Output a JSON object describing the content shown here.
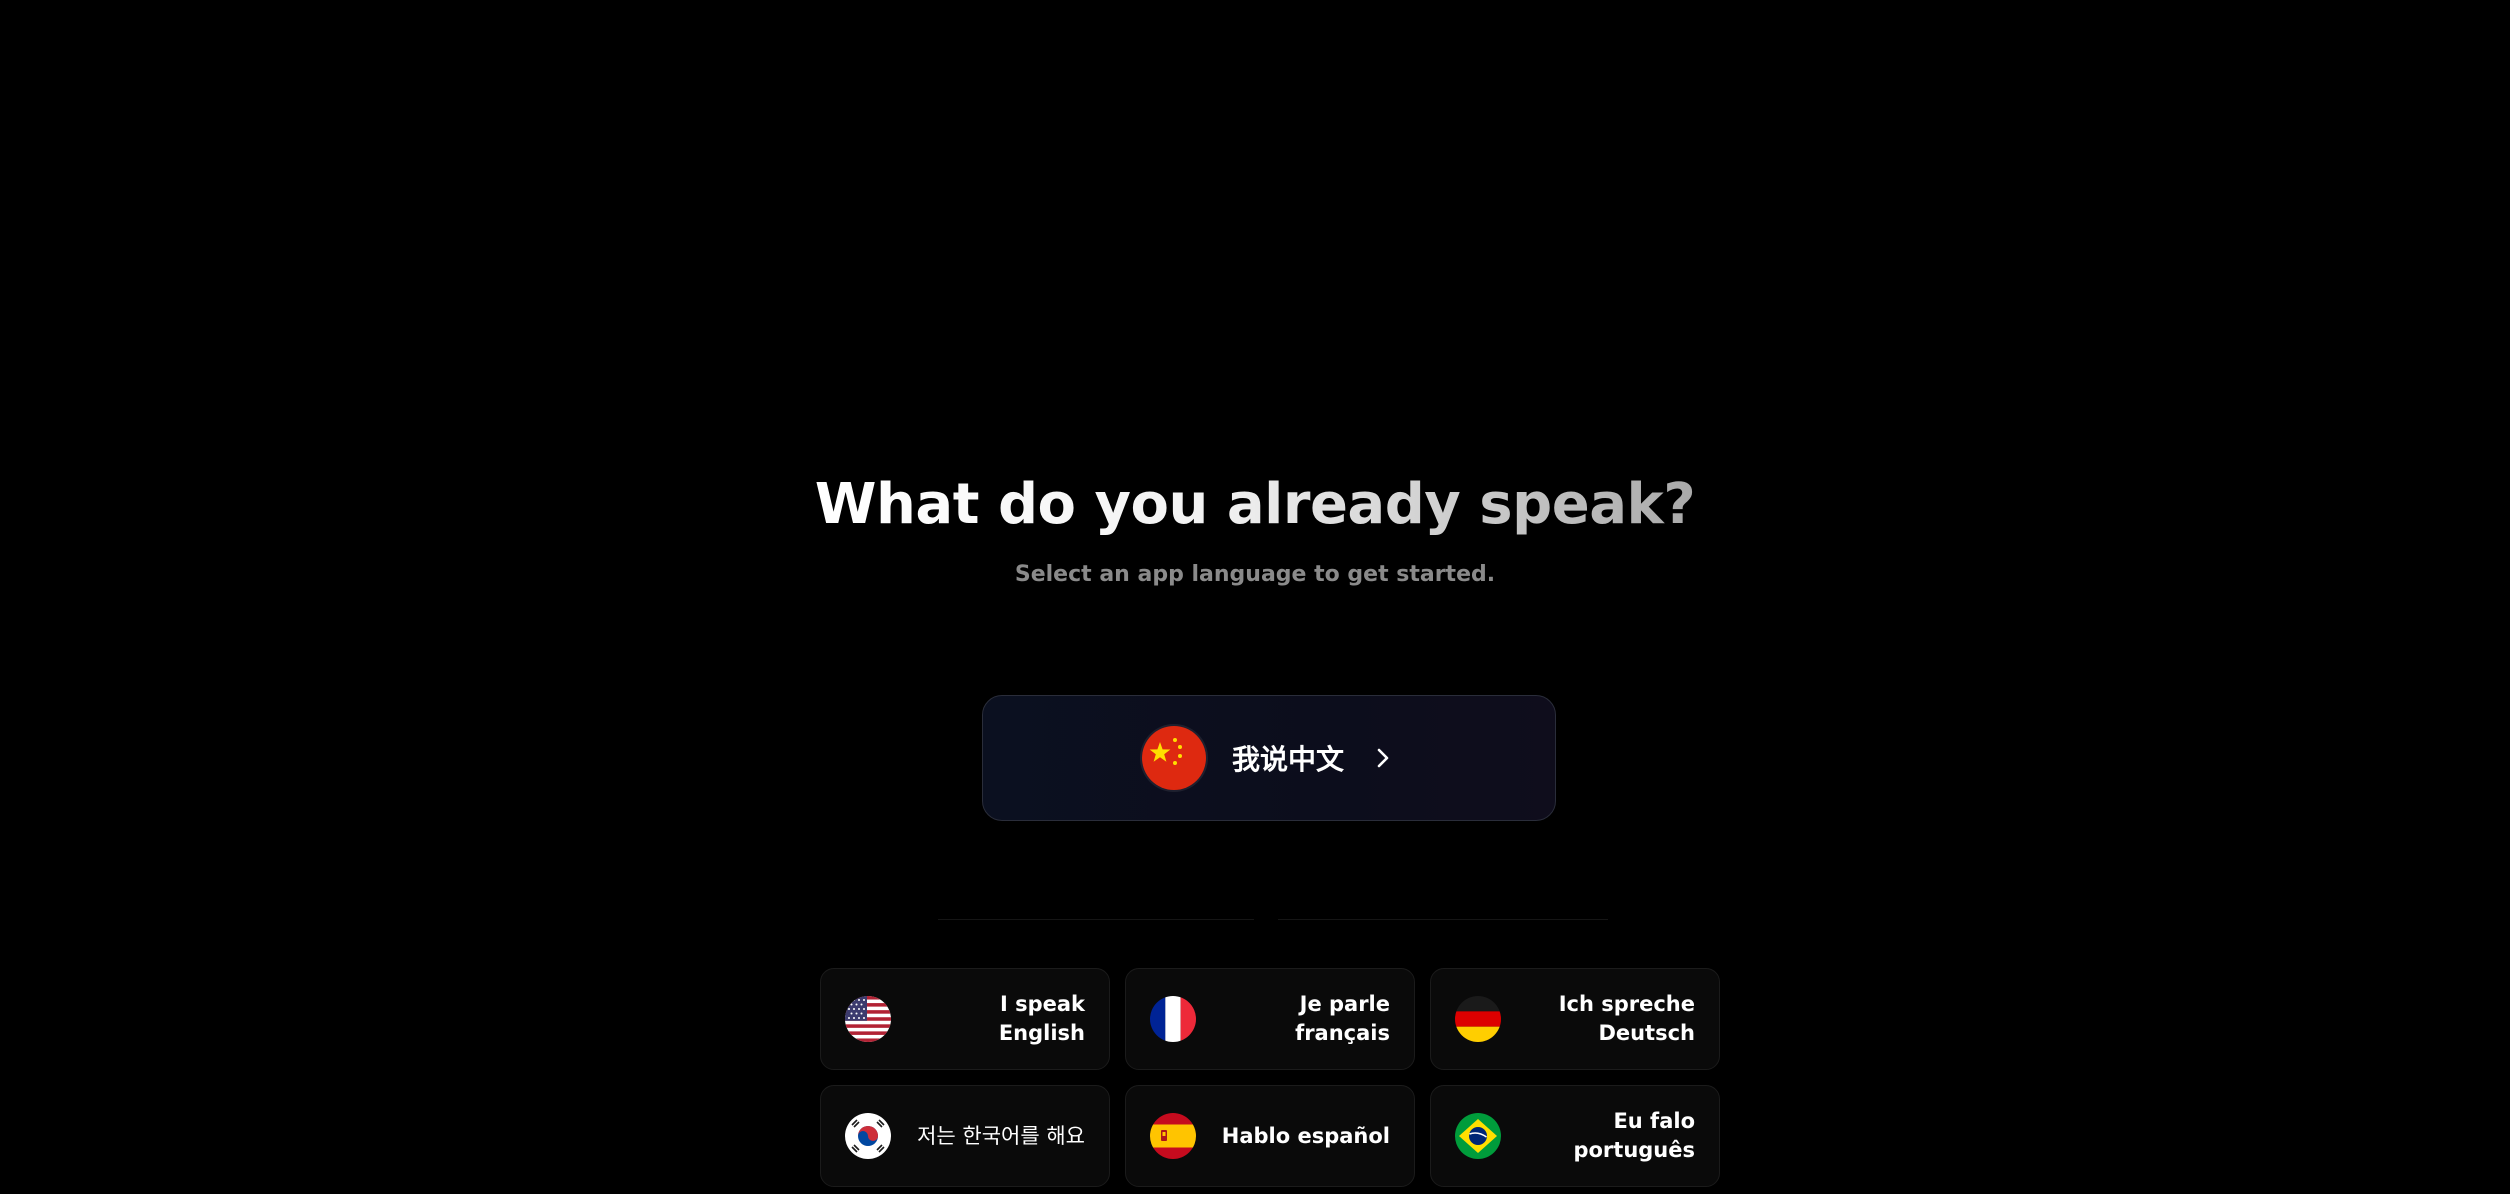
{
  "header": {
    "title": "What do you already speak?",
    "subtitle": "Select an app language to get started."
  },
  "featured": {
    "label": "我说中文",
    "flag_icon": "china-flag-icon",
    "arrow_icon": "chevron-right-icon"
  },
  "languages": [
    {
      "label": "I speak English",
      "flag_icon": "usa-flag-icon"
    },
    {
      "label": "Je parle français",
      "flag_icon": "france-flag-icon"
    },
    {
      "label": "Ich spreche Deutsch",
      "flag_icon": "germany-flag-icon"
    },
    {
      "label": "저는 한국어를 해요",
      "flag_icon": "korea-flag-icon"
    },
    {
      "label": "Hablo español",
      "flag_icon": "spain-flag-icon"
    },
    {
      "label": "Eu falo português",
      "flag_icon": "brazil-flag-icon"
    }
  ],
  "colors": {
    "background": "#000000",
    "featured_border": "#2a2d3a",
    "card_background": "#0a0a0a",
    "subtitle": "#8a8a8a"
  }
}
